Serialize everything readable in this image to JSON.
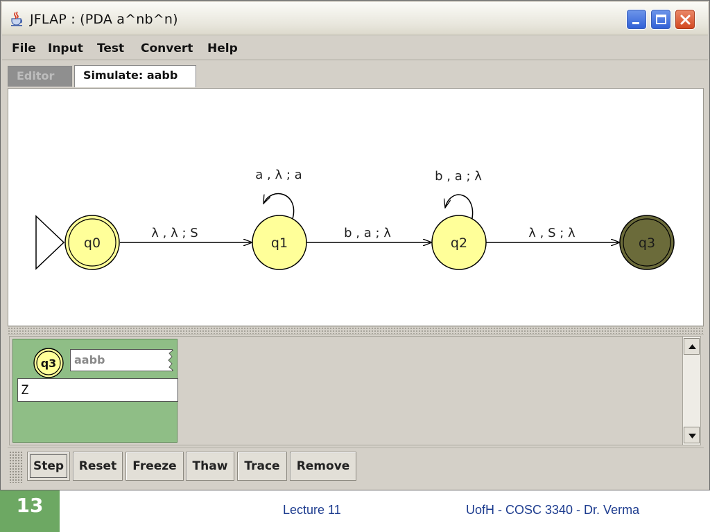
{
  "window": {
    "title": "JFLAP : (PDA a^nb^n)"
  },
  "menu": {
    "items": [
      {
        "label": "File"
      },
      {
        "label": "Input"
      },
      {
        "label": "Test"
      },
      {
        "label": "Convert"
      },
      {
        "label": "Help"
      }
    ]
  },
  "tabs": {
    "editor": "Editor",
    "simulate": "Simulate: aabb"
  },
  "automaton": {
    "states": [
      {
        "id": "q0",
        "label": "q0",
        "initial": true,
        "final": true,
        "active": false
      },
      {
        "id": "q1",
        "label": "q1",
        "initial": false,
        "final": false,
        "active": false
      },
      {
        "id": "q2",
        "label": "q2",
        "initial": false,
        "final": false,
        "active": false
      },
      {
        "id": "q3",
        "label": "q3",
        "initial": false,
        "final": true,
        "active": true
      }
    ],
    "transitions": [
      {
        "from": "q0",
        "to": "q1",
        "label": "λ , λ ; S"
      },
      {
        "from": "q1",
        "to": "q1",
        "label": "a , λ ; a"
      },
      {
        "from": "q1",
        "to": "q2",
        "label": "b , a ; λ"
      },
      {
        "from": "q2",
        "to": "q2",
        "label": "b , a ; λ"
      },
      {
        "from": "q2",
        "to": "q3",
        "label": "λ , S ; λ"
      }
    ],
    "colors": {
      "state_fill": "#ffff99",
      "active_fill": "#6b6b3a",
      "config_card": "#8fbe86"
    }
  },
  "configuration": {
    "state": "q3",
    "input": "aabb",
    "stack": "Z"
  },
  "toolbar": {
    "step": "Step",
    "reset": "Reset",
    "freeze": "Freeze",
    "thaw": "Thaw",
    "trace": "Trace",
    "remove": "Remove"
  },
  "slide": {
    "number": "13",
    "lecture": "Lecture 11",
    "course": "UofH - COSC 3340 - Dr. Verma"
  }
}
